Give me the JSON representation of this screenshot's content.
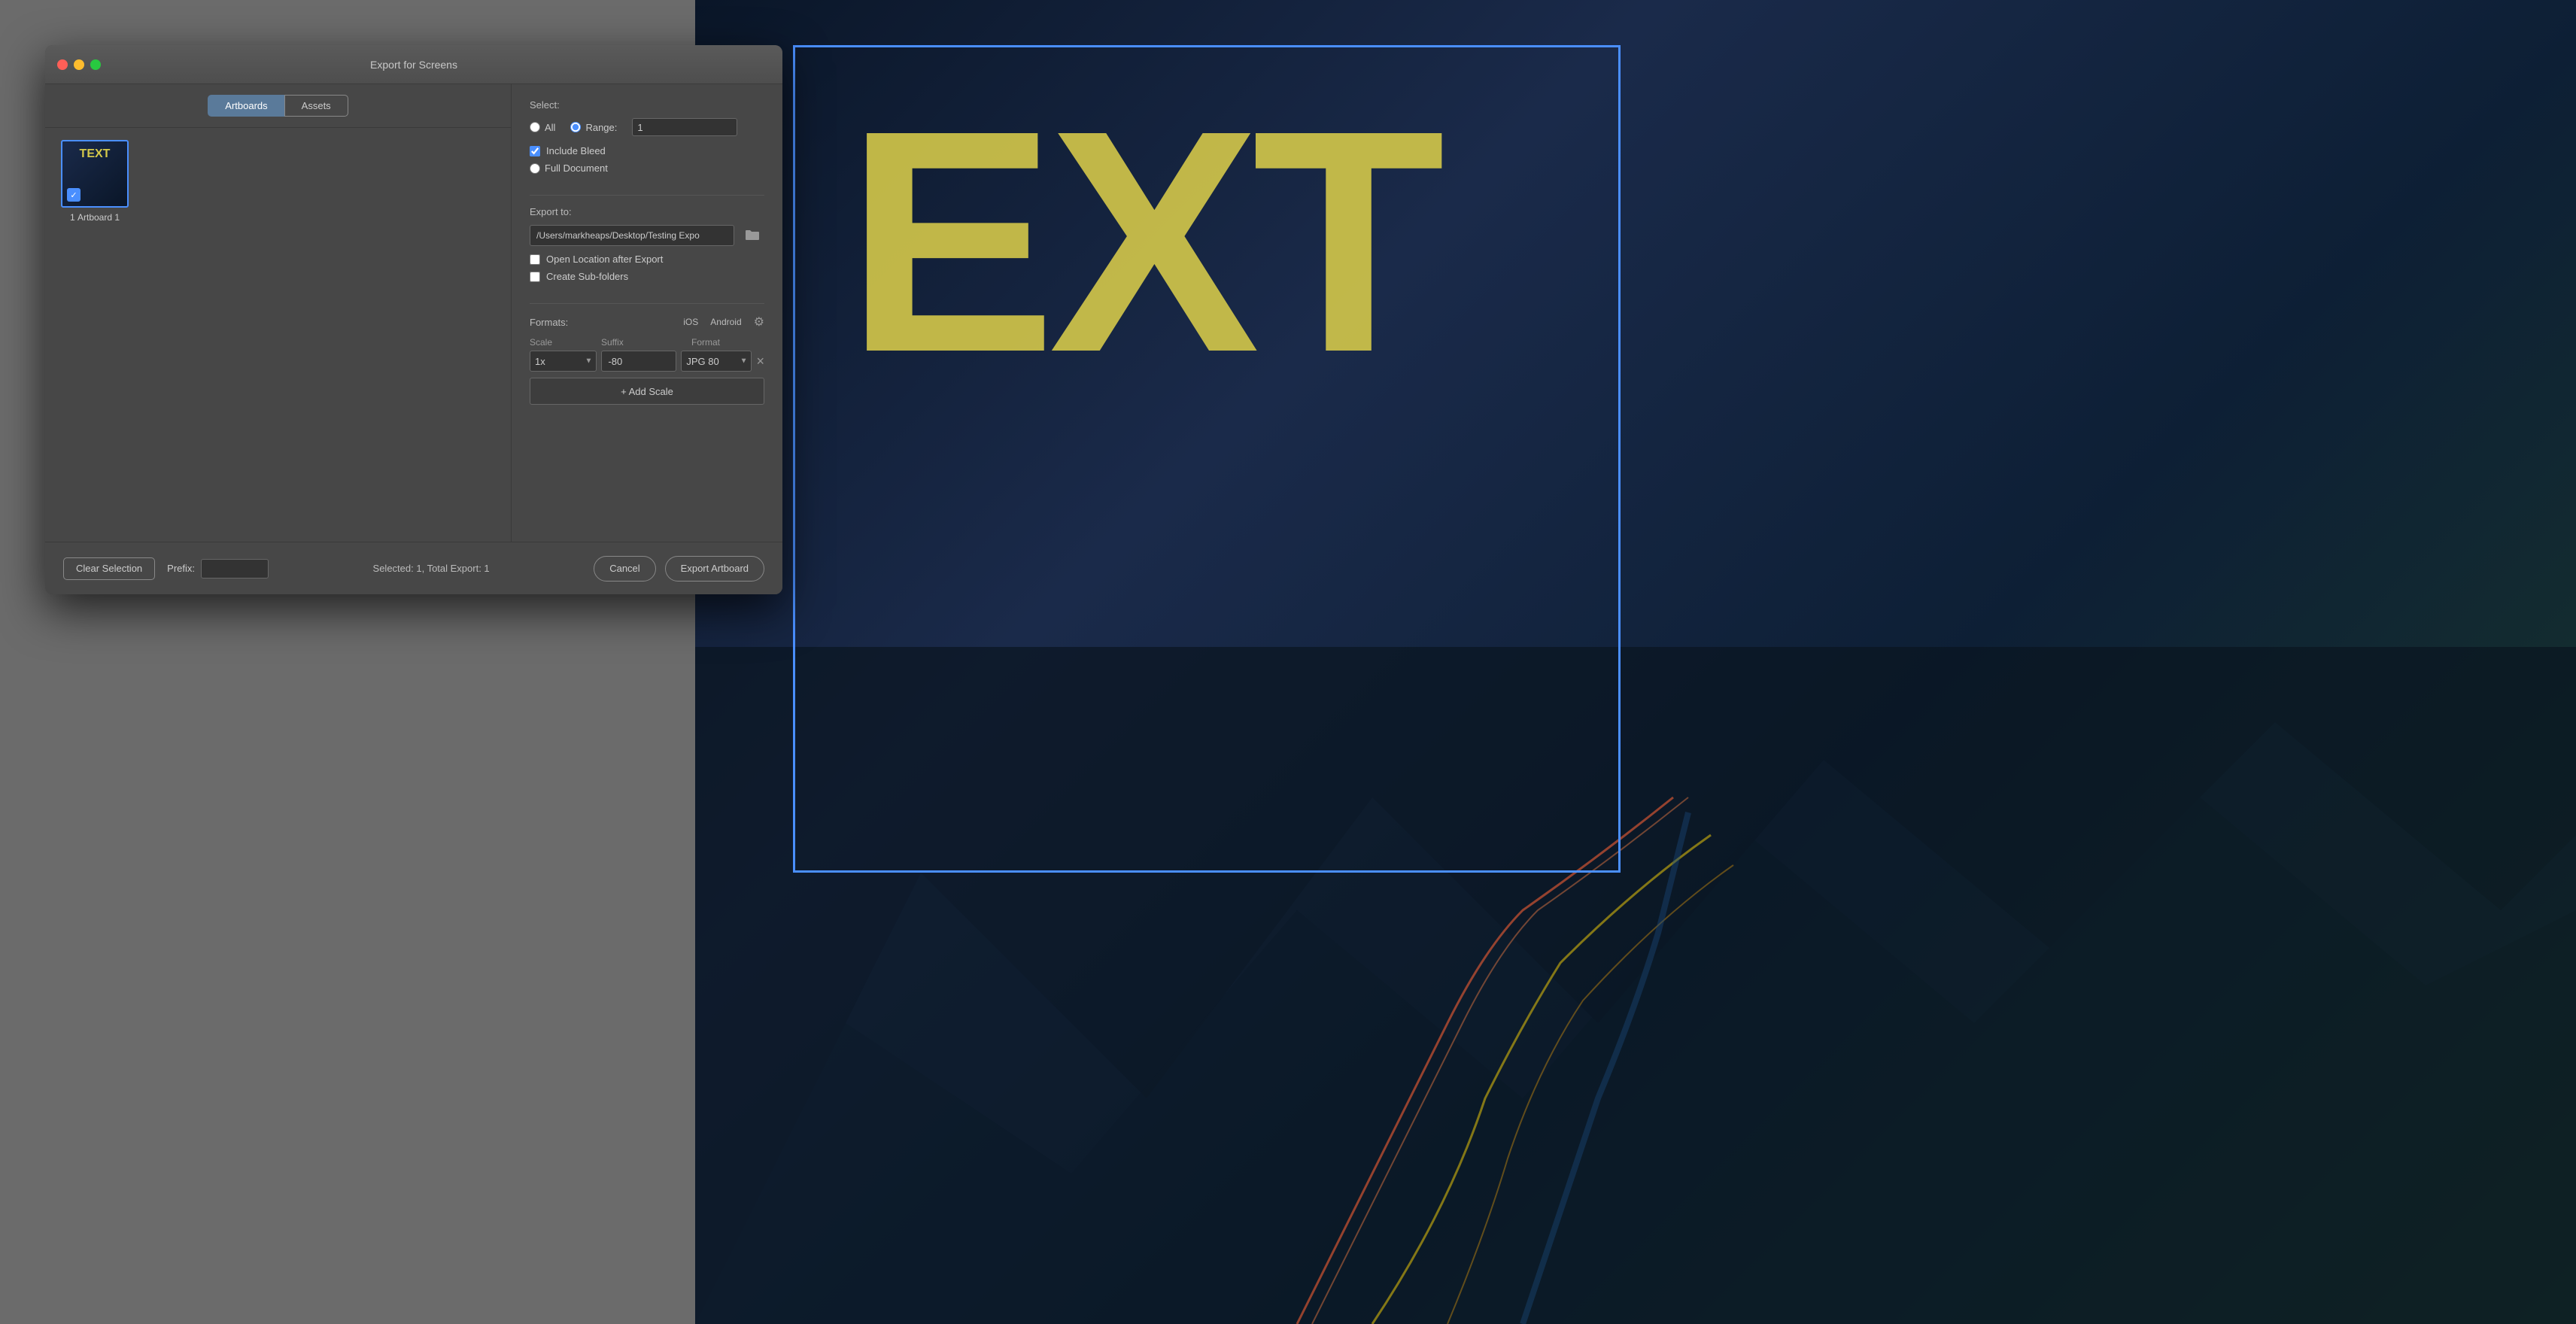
{
  "window": {
    "title": "Export for Screens"
  },
  "tabs": {
    "artboards": "Artboards",
    "assets": "Assets"
  },
  "artboards": [
    {
      "number": "1",
      "label": "Artboard 1",
      "checked": true,
      "thumb_text": "TEXT"
    }
  ],
  "select_section": {
    "label": "Select:",
    "all_label": "All",
    "range_label": "Range:",
    "range_value": "1",
    "include_bleed_label": "Include Bleed",
    "include_bleed_checked": true,
    "full_document_label": "Full Document"
  },
  "export_to": {
    "label": "Export to:",
    "path_value": "/Users/markheaps/Desktop/Testing Expo",
    "open_after_label": "Open Location after Export",
    "create_subfolders_label": "Create Sub-folders"
  },
  "formats": {
    "label": "Formats:",
    "ios_label": "iOS",
    "android_label": "Android",
    "scale_col": "Scale",
    "suffix_col": "Suffix",
    "format_col": "Format",
    "rows": [
      {
        "scale": "1x",
        "suffix": "-80",
        "format": "JPG 80"
      }
    ],
    "add_scale_label": "+ Add Scale"
  },
  "footer": {
    "clear_selection_label": "Clear Selection",
    "prefix_label": "Prefix:",
    "prefix_value": "",
    "status": "Selected: 1, Total Export: 1",
    "cancel_label": "Cancel",
    "export_label": "Export Artboard"
  }
}
